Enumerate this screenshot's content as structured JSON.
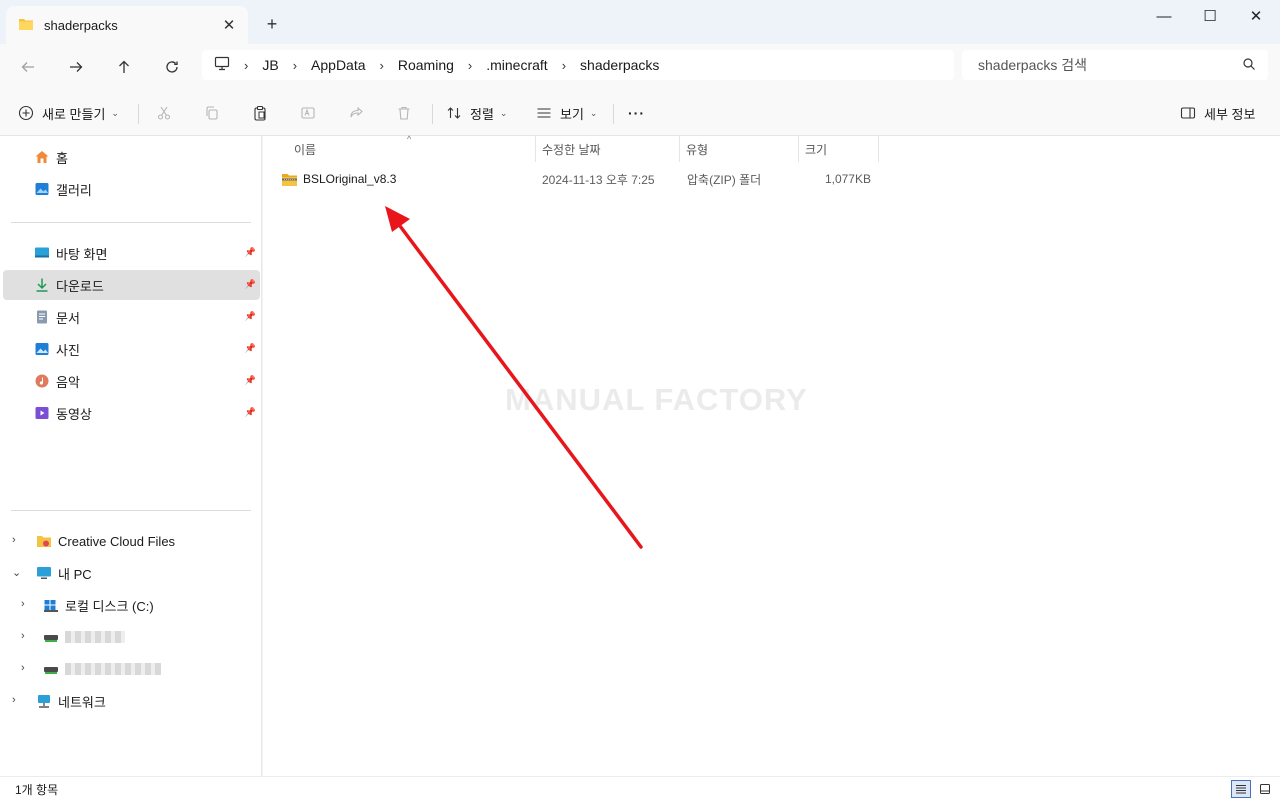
{
  "window": {
    "tab_title": "shaderpacks",
    "tab_close": "✕",
    "new_tab": "+",
    "minimize": "—",
    "maximize": "☐",
    "close": "✕"
  },
  "breadcrumb": [
    "JB",
    "AppData",
    "Roaming",
    ".minecraft",
    "shaderpacks"
  ],
  "breadcrumb_sep": "›",
  "search": {
    "placeholder": "shaderpacks 검색"
  },
  "toolbar": {
    "new_label": "새로 만들기",
    "sort_label": "정렬",
    "view_label": "보기",
    "more_label": "···",
    "details_label": "세부 정보"
  },
  "sidebar": {
    "quick": [
      {
        "label": "홈",
        "icon": "home-icon"
      },
      {
        "label": "갤러리",
        "icon": "gallery-icon"
      }
    ],
    "pinned": [
      {
        "label": "바탕 화면",
        "icon": "desktop-icon"
      },
      {
        "label": "다운로드",
        "icon": "download-icon"
      },
      {
        "label": "문서",
        "icon": "document-icon"
      },
      {
        "label": "사진",
        "icon": "pictures-icon"
      },
      {
        "label": "음악",
        "icon": "music-icon"
      },
      {
        "label": "동영상",
        "icon": "video-icon"
      }
    ],
    "selected": "다운로드",
    "tree": {
      "creative_cloud": "Creative Cloud Files",
      "this_pc": "내 PC",
      "local_disk": "로컬 디스크 (C:)",
      "network": "네트워크"
    }
  },
  "columns": {
    "name": "이름",
    "modified": "수정한 날짜",
    "type": "유형",
    "size": "크기"
  },
  "files": [
    {
      "name": "BSLOriginal_v8.3",
      "modified": "2024-11-13 오후 7:25",
      "type": "압축(ZIP) 폴더",
      "size": "1,077KB"
    }
  ],
  "watermark": "MANUAL FACTORY",
  "status": {
    "item_count": "1개 항목"
  },
  "colors": {
    "folder": "#f5c342",
    "zip_band": "#6b6b6b",
    "annotation_arrow": "#e8161b",
    "selection_bg": "#e0e0e0",
    "accent": "#0067c0"
  }
}
